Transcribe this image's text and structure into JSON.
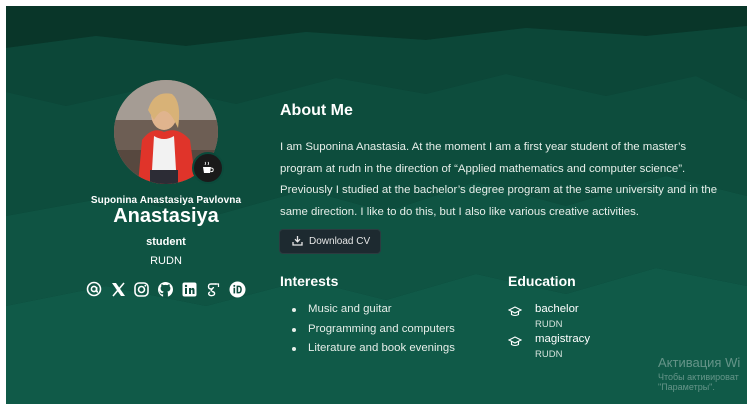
{
  "profile": {
    "full_name": "Suponina Anastasiya Pavlovna",
    "first_name": "Anastasiya",
    "role": "student",
    "organization": "RUDN",
    "avatar_badge_icon": "coffee-cup-icon",
    "social_icons": [
      "email-icon",
      "x-twitter-icon",
      "instagram-icon",
      "github-icon",
      "linkedin-icon",
      "google-scholar-icon",
      "orcid-icon"
    ]
  },
  "about": {
    "title": "About Me",
    "text": "I am Suponina Anastasia. At the moment I am a first year student of the master’s program at rudn in the direction of “Applied mathematics and computer science”. Previously I studied at the bachelor’s degree program at the same university and in the same direction. I like to do this, but I also like various creative activities.",
    "download_label": "Download CV"
  },
  "interests": {
    "title": "Interests",
    "items": [
      "Music and guitar",
      "Programming and computers",
      "Literature and book evenings"
    ]
  },
  "education": {
    "title": "Education",
    "items": [
      {
        "degree": "bachelor",
        "school": "RUDN"
      },
      {
        "degree": "magistracy",
        "school": "RUDN"
      }
    ]
  },
  "watermark": {
    "line1": "Активация Wi",
    "line2": "Чтобы активироват",
    "line3": "\"Параметры\"."
  },
  "colors": {
    "background": "#0b4a3b",
    "button_bg": "#1d2a30"
  }
}
